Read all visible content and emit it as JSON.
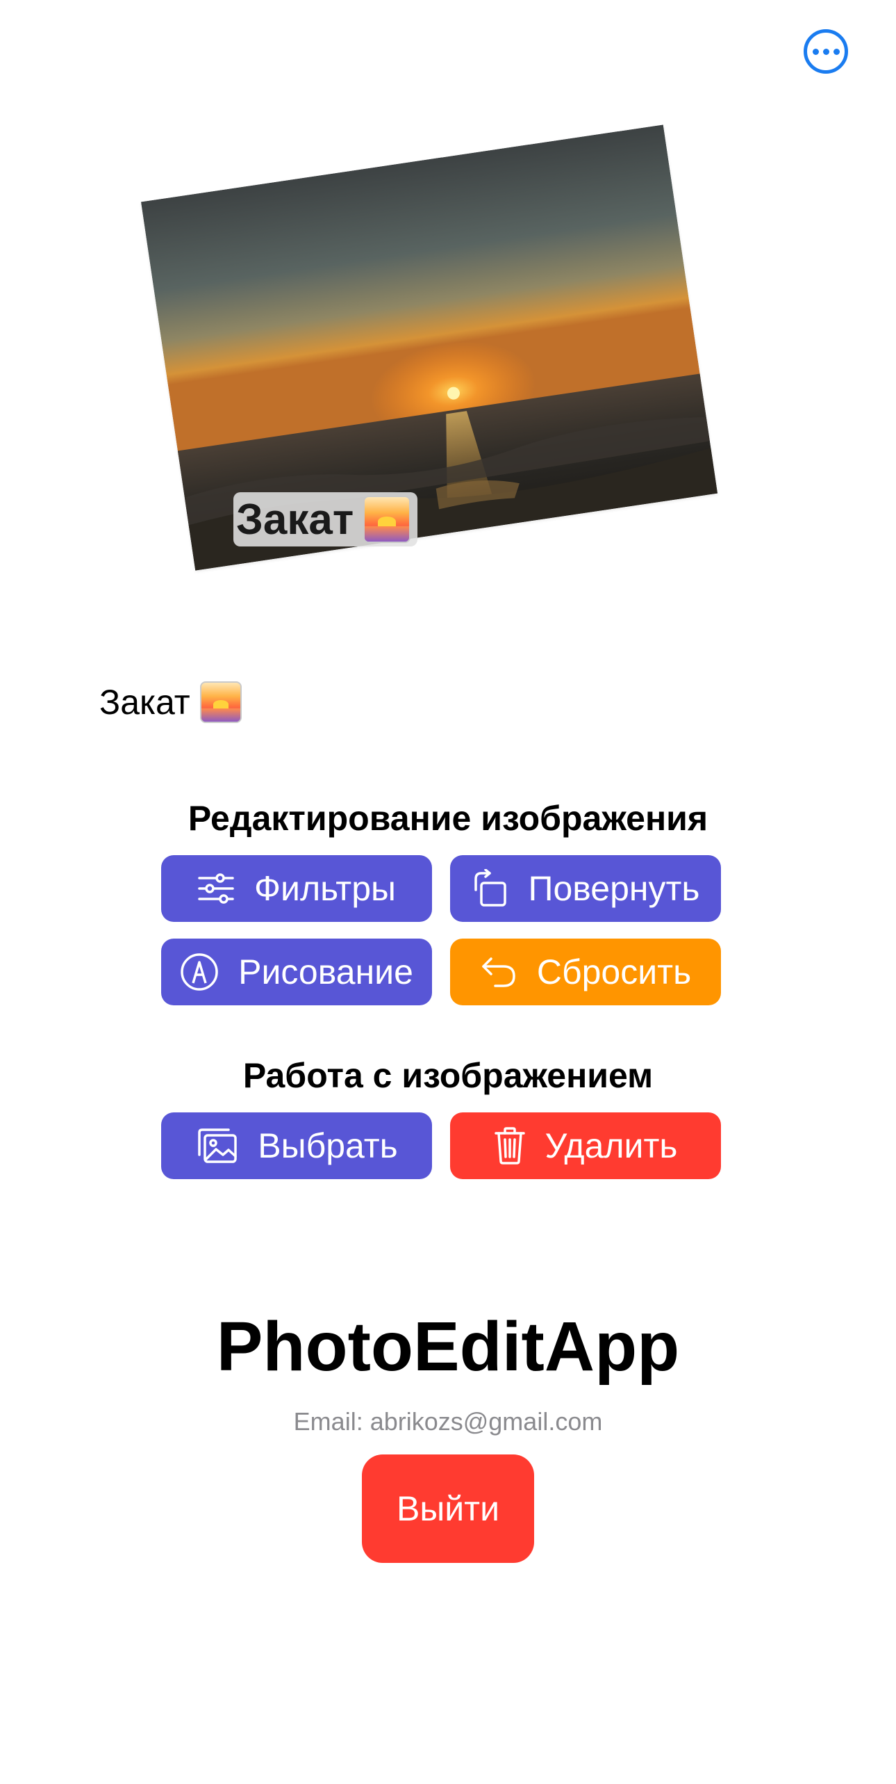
{
  "toolbar": {
    "more_icon": "ellipsis-circle-icon",
    "accent_color": "#1a7cf0"
  },
  "photo": {
    "overlay_text": "Закат",
    "overlay_emoji_icon": "sunrise-emoji-icon"
  },
  "caption": {
    "text": "Закат",
    "emoji_icon": "sunrise-emoji-icon"
  },
  "editing": {
    "title": "Редактирование изображения",
    "buttons": [
      {
        "label": "Фильтры",
        "icon": "sliders-icon",
        "color": "#5856d6"
      },
      {
        "label": "Повернуть",
        "icon": "rotate-icon",
        "color": "#5856d6"
      },
      {
        "label": "Рисование",
        "icon": "pencil-tip-circle-icon",
        "color": "#5856d6"
      },
      {
        "label": "Сбросить",
        "icon": "undo-arrow-icon",
        "color": "#ff9500"
      }
    ]
  },
  "image_actions": {
    "title": "Работа с изображением",
    "buttons": [
      {
        "label": "Выбрать",
        "icon": "photos-stack-icon",
        "color": "#5856d6"
      },
      {
        "label": "Удалить",
        "icon": "trash-icon",
        "color": "#ff3b30"
      }
    ]
  },
  "footer": {
    "app_name": "PhotoEditApp",
    "email": "Email: abrikozs@gmail.com",
    "logout_label": "Выйти",
    "logout_color": "#ff3b30"
  }
}
